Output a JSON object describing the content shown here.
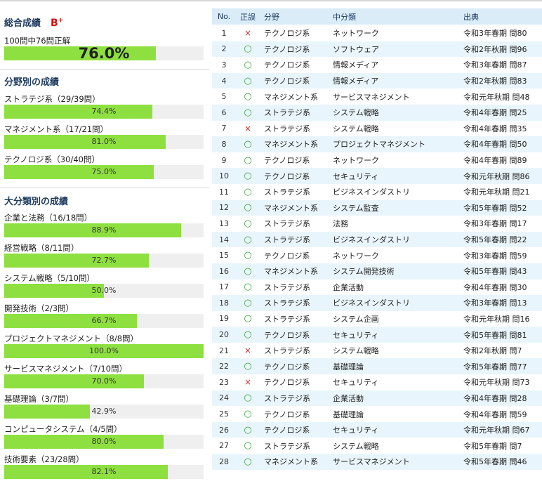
{
  "overall": {
    "title": "総合成績",
    "grade": "B",
    "grade_suffix": "+",
    "summary": "100問中76問正解",
    "percent_text": "76.0%",
    "rate": 0.76
  },
  "field": {
    "title": "分野別の成績",
    "items": [
      {
        "label": "ストラテジ系（29/39問）",
        "percent": "74.4%",
        "rate": 0.744
      },
      {
        "label": "マネジメント系（17/21問）",
        "percent": "81.0%",
        "rate": 0.81
      },
      {
        "label": "テクノロジ系（30/40問）",
        "percent": "75.0%",
        "rate": 0.75
      }
    ]
  },
  "category": {
    "title": "大分類別の成績",
    "items": [
      {
        "label": "企業と法務（16/18問）",
        "percent": "88.9%",
        "rate": 0.889
      },
      {
        "label": "経営戦略（8/11問）",
        "percent": "72.7%",
        "rate": 0.727
      },
      {
        "label": "システム戦略（5/10問）",
        "percent": "50.0%",
        "rate": 0.5
      },
      {
        "label": "開発技術（2/3問）",
        "percent": "66.7%",
        "rate": 0.667
      },
      {
        "label": "プロジェクトマネジメント（8/8問）",
        "percent": "100.0%",
        "rate": 1.0
      },
      {
        "label": "サービスマネジメント（7/10問）",
        "percent": "70.0%",
        "rate": 0.7
      },
      {
        "label": "基礎理論（3/7問）",
        "percent": "42.9%",
        "rate": 0.429
      },
      {
        "label": "コンピュータシステム（4/5問）",
        "percent": "80.0%",
        "rate": 0.8
      },
      {
        "label": "技術要素（23/28問）",
        "percent": "82.1%",
        "rate": 0.821
      }
    ]
  },
  "table": {
    "headers": {
      "no": "No.",
      "result": "正誤",
      "field": "分野",
      "sub": "中分類",
      "source": "出典"
    },
    "symbols": {
      "correct": "○",
      "wrong": "×"
    },
    "rows": [
      {
        "no": "1",
        "result": "wrong",
        "field": "テクノロジ系",
        "sub": "ネットワーク",
        "source": "令和3年春期 問80"
      },
      {
        "no": "2",
        "result": "correct",
        "field": "テクノロジ系",
        "sub": "ソフトウェア",
        "source": "令和2年秋期 問96"
      },
      {
        "no": "3",
        "result": "correct",
        "field": "テクノロジ系",
        "sub": "情報メディア",
        "source": "令和3年春期 問87"
      },
      {
        "no": "4",
        "result": "correct",
        "field": "テクノロジ系",
        "sub": "情報メディア",
        "source": "令和2年秋期 問83"
      },
      {
        "no": "5",
        "result": "correct",
        "field": "マネジメント系",
        "sub": "サービスマネジメント",
        "source": "令和元年秋期 問48"
      },
      {
        "no": "6",
        "result": "correct",
        "field": "ストラテジ系",
        "sub": "システム戦略",
        "source": "令和4年春期 問25"
      },
      {
        "no": "7",
        "result": "wrong",
        "field": "ストラテジ系",
        "sub": "システム戦略",
        "source": "令和4年春期 問35"
      },
      {
        "no": "8",
        "result": "correct",
        "field": "マネジメント系",
        "sub": "プロジェクトマネジメント",
        "source": "令和4年春期 問50"
      },
      {
        "no": "9",
        "result": "correct",
        "field": "テクノロジ系",
        "sub": "ネットワーク",
        "source": "令和4年春期 問89"
      },
      {
        "no": "10",
        "result": "correct",
        "field": "テクノロジ系",
        "sub": "セキュリティ",
        "source": "令和元年秋期 問86"
      },
      {
        "no": "11",
        "result": "correct",
        "field": "ストラテジ系",
        "sub": "ビジネスインダストリ",
        "source": "令和元年秋期 問21"
      },
      {
        "no": "12",
        "result": "correct",
        "field": "マネジメント系",
        "sub": "システム監査",
        "source": "令和5年春期 問52"
      },
      {
        "no": "13",
        "result": "correct",
        "field": "ストラテジ系",
        "sub": "法務",
        "source": "令和3年春期 問17"
      },
      {
        "no": "14",
        "result": "correct",
        "field": "ストラテジ系",
        "sub": "ビジネスインダストリ",
        "source": "令和5年春期 問22"
      },
      {
        "no": "15",
        "result": "correct",
        "field": "テクノロジ系",
        "sub": "ネットワーク",
        "source": "令和3年春期 問59"
      },
      {
        "no": "16",
        "result": "correct",
        "field": "マネジメント系",
        "sub": "システム開発技術",
        "source": "令和5年春期 問43"
      },
      {
        "no": "17",
        "result": "correct",
        "field": "ストラテジ系",
        "sub": "企業活動",
        "source": "令和4年春期 問30"
      },
      {
        "no": "18",
        "result": "correct",
        "field": "ストラテジ系",
        "sub": "ビジネスインダストリ",
        "source": "令和3年春期 問13"
      },
      {
        "no": "19",
        "result": "correct",
        "field": "ストラテジ系",
        "sub": "システム企画",
        "source": "令和元年秋期 問16"
      },
      {
        "no": "20",
        "result": "correct",
        "field": "テクノロジ系",
        "sub": "セキュリティ",
        "source": "令和5年春期 問81"
      },
      {
        "no": "21",
        "result": "wrong",
        "field": "ストラテジ系",
        "sub": "システム戦略",
        "source": "令和2年秋期 問7"
      },
      {
        "no": "22",
        "result": "correct",
        "field": "テクノロジ系",
        "sub": "基礎理論",
        "source": "令和5年春期 問77"
      },
      {
        "no": "23",
        "result": "wrong",
        "field": "テクノロジ系",
        "sub": "セキュリティ",
        "source": "令和元年秋期 問73"
      },
      {
        "no": "24",
        "result": "correct",
        "field": "ストラテジ系",
        "sub": "企業活動",
        "source": "令和4年春期 問28"
      },
      {
        "no": "25",
        "result": "correct",
        "field": "テクノロジ系",
        "sub": "基礎理論",
        "source": "令和4年春期 問59"
      },
      {
        "no": "26",
        "result": "correct",
        "field": "テクノロジ系",
        "sub": "セキュリティ",
        "source": "令和元年秋期 問67"
      },
      {
        "no": "27",
        "result": "correct",
        "field": "ストラテジ系",
        "sub": "システム戦略",
        "source": "令和5年春期 問7"
      },
      {
        "no": "28",
        "result": "correct",
        "field": "マネジメント系",
        "sub": "サービスマネジメント",
        "source": "令和5年春期 問46"
      }
    ]
  }
}
